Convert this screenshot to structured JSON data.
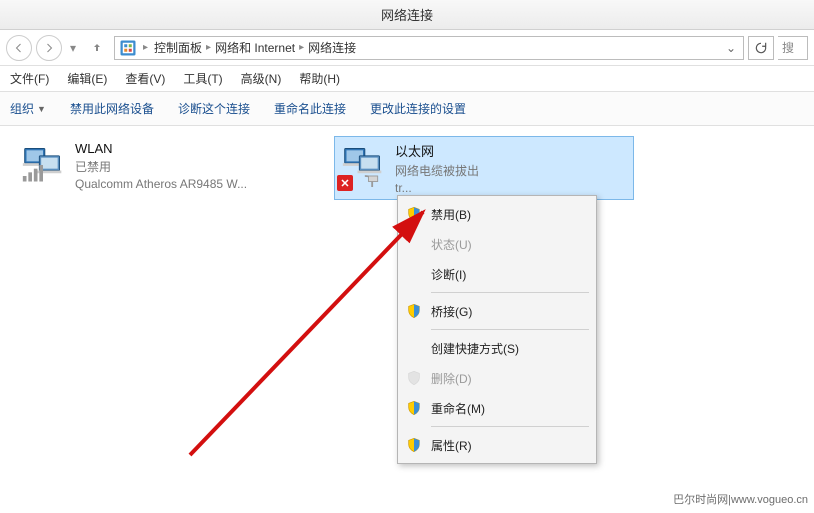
{
  "window": {
    "title": "网络连接"
  },
  "address": {
    "segments": [
      "控制面板",
      "网络和 Internet",
      "网络连接"
    ]
  },
  "search": {
    "placeholder": "搜"
  },
  "menu": {
    "file": "文件(F)",
    "edit": "编辑(E)",
    "view": "查看(V)",
    "tools": "工具(T)",
    "advanced": "高级(N)",
    "help": "帮助(H)"
  },
  "toolbar": {
    "organize": "组织",
    "disable": "禁用此网络设备",
    "diagnose": "诊断这个连接",
    "rename": "重命名此连接",
    "change": "更改此连接的设置"
  },
  "connections": {
    "wlan": {
      "title": "WLAN",
      "status": "已禁用",
      "adapter": "Qualcomm Atheros AR9485 W..."
    },
    "ethernet": {
      "title": "以太网",
      "status": "网络电缆被拔出",
      "adapter": "tr..."
    }
  },
  "context_menu": {
    "disable": "禁用(B)",
    "status": "状态(U)",
    "diagnose": "诊断(I)",
    "bridge": "桥接(G)",
    "shortcut": "创建快捷方式(S)",
    "delete": "删除(D)",
    "rename": "重命名(M)",
    "properties": "属性(R)"
  },
  "watermark": "巴尔时尚网|www.vogueo.cn"
}
